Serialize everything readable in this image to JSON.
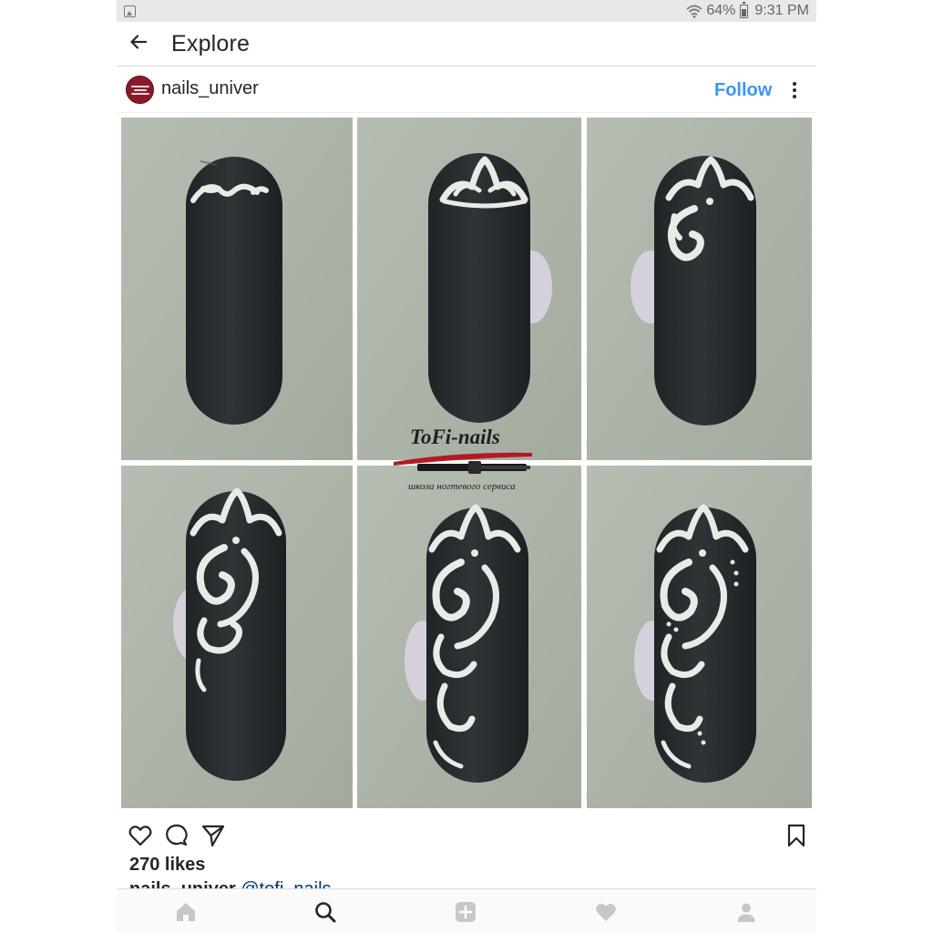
{
  "status_bar": {
    "battery": "64%",
    "time": "9:31 PM"
  },
  "app_bar": {
    "title": "Explore"
  },
  "post": {
    "username": "nails_univer",
    "follow_label": "Follow",
    "photo": {
      "brand": "ToFi-nails",
      "brand_tagline": "школа ногтевого сервиса",
      "steps": 6,
      "colors": {
        "background": "#aab1a7",
        "nail": "#272d2e",
        "ornament": "#e9ebe6"
      }
    },
    "likes": "270 likes",
    "caption_user": "nails_univer",
    "caption_mention": "@tofi_nails"
  },
  "icons": {
    "back": "arrow-left-icon",
    "more": "more-vertical-icon",
    "like": "heart-outline-icon",
    "comment": "comment-icon",
    "share": "paper-plane-icon",
    "save": "bookmark-icon",
    "nav": [
      "home-icon",
      "search-icon",
      "add-icon",
      "heart-icon",
      "profile-icon"
    ]
  },
  "colors": {
    "accent": "#3897f0",
    "text": "#262626",
    "nav_inactive": "#c7c7c7",
    "nav_active": "#262626"
  }
}
